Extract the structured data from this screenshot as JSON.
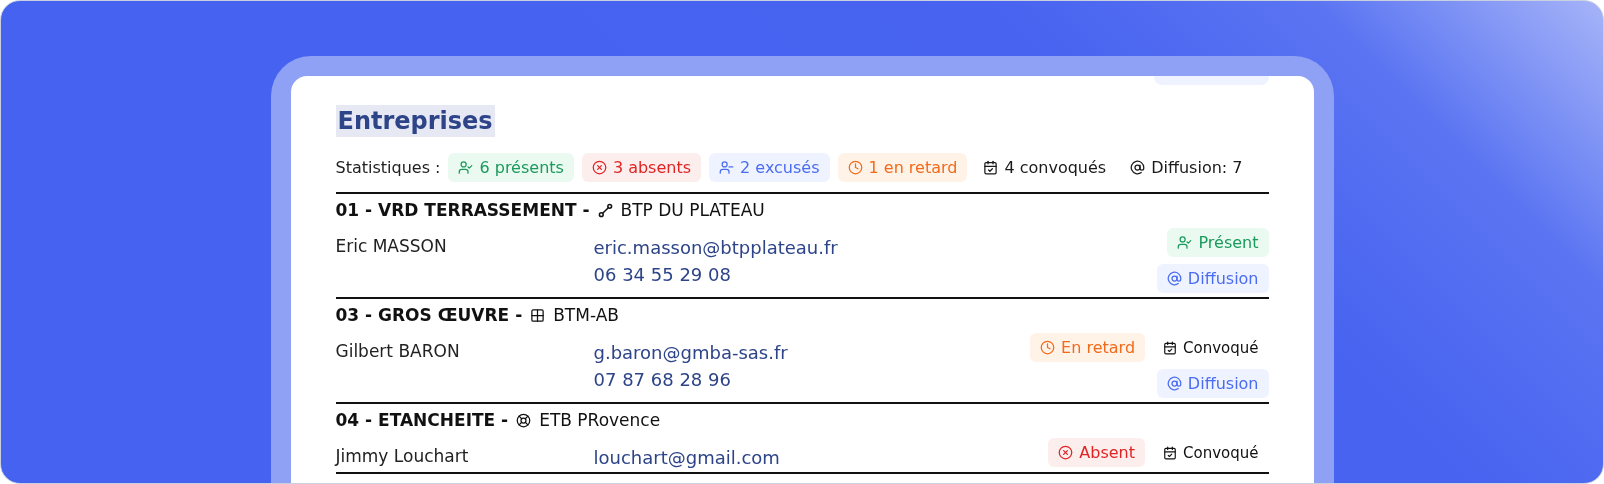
{
  "title": "Entreprises",
  "statistics": {
    "label": "Statistiques :",
    "items": [
      {
        "kind": "present",
        "label": "6 présents"
      },
      {
        "kind": "absent",
        "label": "3 absents"
      },
      {
        "kind": "excused",
        "label": "2 excusés"
      },
      {
        "kind": "late",
        "label": "1 en retard"
      },
      {
        "kind": "convoked",
        "label": "4 convoqués"
      },
      {
        "kind": "diffusion",
        "label": "Diffusion: 7"
      }
    ]
  },
  "companies": [
    {
      "lot": "01 - VRD TERRASSEMENT -",
      "name": "BTP DU PLATEAU",
      "contacts": [
        {
          "name": "Eric MASSON",
          "email": "eric.masson@btpplateau.fr",
          "phone": "06 34 55 29 08",
          "status": {
            "kind": "present",
            "label": "Présent"
          },
          "diffusion": "Diffusion"
        }
      ]
    },
    {
      "lot": "03 - GROS ŒUVRE -",
      "name": "BTM-AB",
      "contacts": [
        {
          "name": "Gilbert BARON",
          "email": "g.baron@gmba-sas.fr",
          "phone": "07 87 68 28 96",
          "status": {
            "kind": "late",
            "label": "En retard"
          },
          "convocation": "Convoqué",
          "diffusion": "Diffusion"
        }
      ]
    },
    {
      "lot": "04 - ETANCHEITE -",
      "name": "ETB PRovence",
      "contacts": [
        {
          "name": "Jimmy Louchart",
          "email": "louchart@gmail.com",
          "status": {
            "kind": "absent",
            "label": "Absent"
          },
          "convocation": "Convoqué"
        }
      ]
    }
  ]
}
